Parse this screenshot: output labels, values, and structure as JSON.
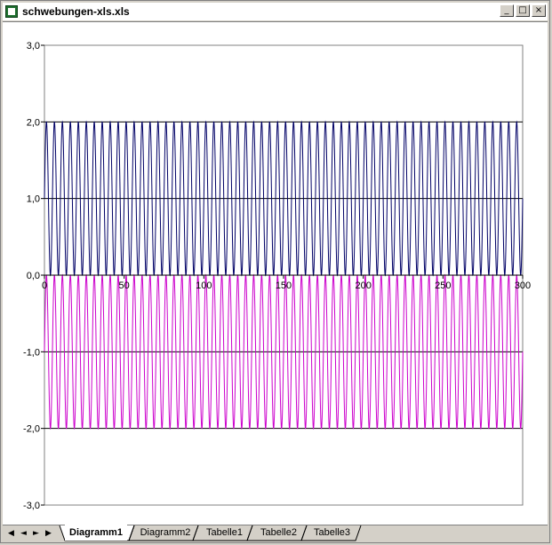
{
  "window": {
    "title": "schwebungen-xls.xls",
    "minimize_label": "_",
    "maximize_label": "□",
    "close_label": "×"
  },
  "chart_data": {
    "type": "line",
    "xlim": [
      0,
      300
    ],
    "ylim": [
      -3,
      3
    ],
    "x_ticks": [
      "0",
      "50",
      "100",
      "150",
      "200",
      "250",
      "300"
    ],
    "y_ticks": [
      "3,0",
      "2,0",
      "1,0",
      "0,0",
      "-1,0",
      "-2,0",
      "-3,0"
    ],
    "gridlines_y": true,
    "series": [
      {
        "color": "#000066",
        "mean": 1,
        "amplitude": 1,
        "cycles": 60
      },
      {
        "color": "#cc00cc",
        "mean": -1,
        "amplitude": 1,
        "cycles": 60
      }
    ]
  },
  "nav": {
    "first": "◀",
    "prev": "◄",
    "next": "►",
    "last": "▶"
  },
  "tabs": [
    {
      "label": "Diagramm1",
      "active": true
    },
    {
      "label": "Diagramm2",
      "active": false
    },
    {
      "label": "Tabelle1",
      "active": false
    },
    {
      "label": "Tabelle2",
      "active": false
    },
    {
      "label": "Tabelle3",
      "active": false
    }
  ]
}
